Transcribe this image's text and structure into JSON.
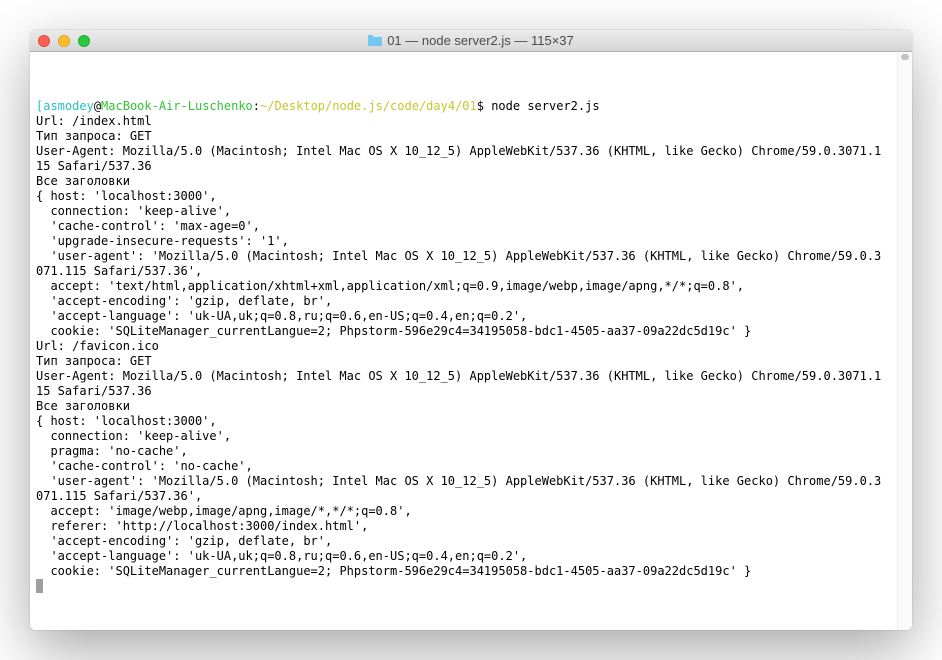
{
  "window": {
    "title": "01 — node server2.js — 115×37"
  },
  "prompt": {
    "open_bracket": "[",
    "user": "asmodey",
    "at": "@",
    "host": "MacBook-Air-Luschenko",
    "colon": ":",
    "path": "~/Desktop/node.js/code/day4/01",
    "close": "$ ",
    "command": "node server2.js"
  },
  "output": {
    "line1": "Url: /index.html",
    "line2": "Тип запроса: GET",
    "line3": "User-Agent: Mozilla/5.0 (Macintosh; Intel Mac OS X 10_12_5) AppleWebKit/537.36 (KHTML, like Gecko) Chrome/59.0.3071.115 Safari/537.36",
    "line4": "Все заголовки",
    "line5": "{ host: 'localhost:3000',",
    "line6": "  connection: 'keep-alive',",
    "line7": "  'cache-control': 'max-age=0',",
    "line8": "  'upgrade-insecure-requests': '1',",
    "line9": "  'user-agent': 'Mozilla/5.0 (Macintosh; Intel Mac OS X 10_12_5) AppleWebKit/537.36 (KHTML, like Gecko) Chrome/59.0.3071.115 Safari/537.36',",
    "line10": "  accept: 'text/html,application/xhtml+xml,application/xml;q=0.9,image/webp,image/apng,*/*;q=0.8',",
    "line11": "  'accept-encoding': 'gzip, deflate, br',",
    "line12": "  'accept-language': 'uk-UA,uk;q=0.8,ru;q=0.6,en-US;q=0.4,en;q=0.2',",
    "line13": "  cookie: 'SQLiteManager_currentLangue=2; Phpstorm-596e29c4=34195058-bdc1-4505-aa37-09a22dc5d19c' }",
    "line14": "Url: /favicon.ico",
    "line15": "Тип запроса: GET",
    "line16": "User-Agent: Mozilla/5.0 (Macintosh; Intel Mac OS X 10_12_5) AppleWebKit/537.36 (KHTML, like Gecko) Chrome/59.0.3071.115 Safari/537.36",
    "line17": "Все заголовки",
    "line18": "{ host: 'localhost:3000',",
    "line19": "  connection: 'keep-alive',",
    "line20": "  pragma: 'no-cache',",
    "line21": "  'cache-control': 'no-cache',",
    "line22": "  'user-agent': 'Mozilla/5.0 (Macintosh; Intel Mac OS X 10_12_5) AppleWebKit/537.36 (KHTML, like Gecko) Chrome/59.0.3071.115 Safari/537.36',",
    "line23": "  accept: 'image/webp,image/apng,image/*,*/*;q=0.8',",
    "line24": "  referer: 'http://localhost:3000/index.html',",
    "line25": "  'accept-encoding': 'gzip, deflate, br',",
    "line26": "  'accept-language': 'uk-UA,uk;q=0.8,ru;q=0.6,en-US;q=0.4,en;q=0.2',",
    "line27": "  cookie: 'SQLiteManager_currentLangue=2; Phpstorm-596e29c4=34195058-bdc1-4505-aa37-09a22dc5d19c' }"
  }
}
